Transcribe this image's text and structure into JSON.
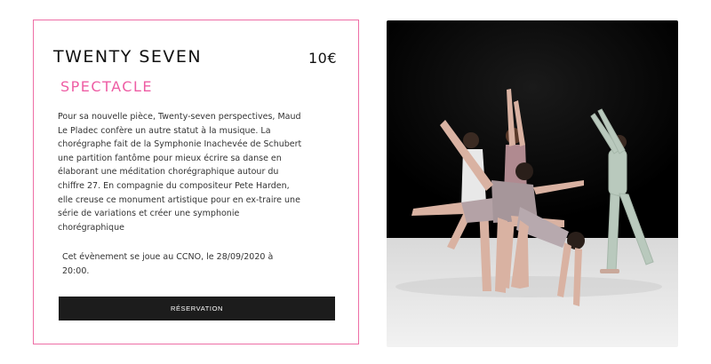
{
  "event": {
    "title": "TWENTY SEVEN",
    "price": "10€",
    "category": "SPECTACLE",
    "description": "Pour sa nouvelle pièce, Twenty-seven perspectives, Maud Le Pladec confère un autre statut à la musique. La chorégraphe fait de la Symphonie Inachevée de Schubert une partition fantôme pour mieux écrire sa danse en élaborant une méditation chorégraphique autour du chiffre 27. En compagnie du compositeur Pete Harden, elle creuse ce monument artistique pour en ex-traire une série de variations et créer une symphonie chorégraphique",
    "venue_info": "Cet évènement se joue au CCNO, le 28/09/2020 à 20:00.",
    "button_label": "RÉSERVATION"
  },
  "colors": {
    "accent": "#ee5da4",
    "border": "#ee6fa6",
    "button": "#1c1c1c"
  }
}
